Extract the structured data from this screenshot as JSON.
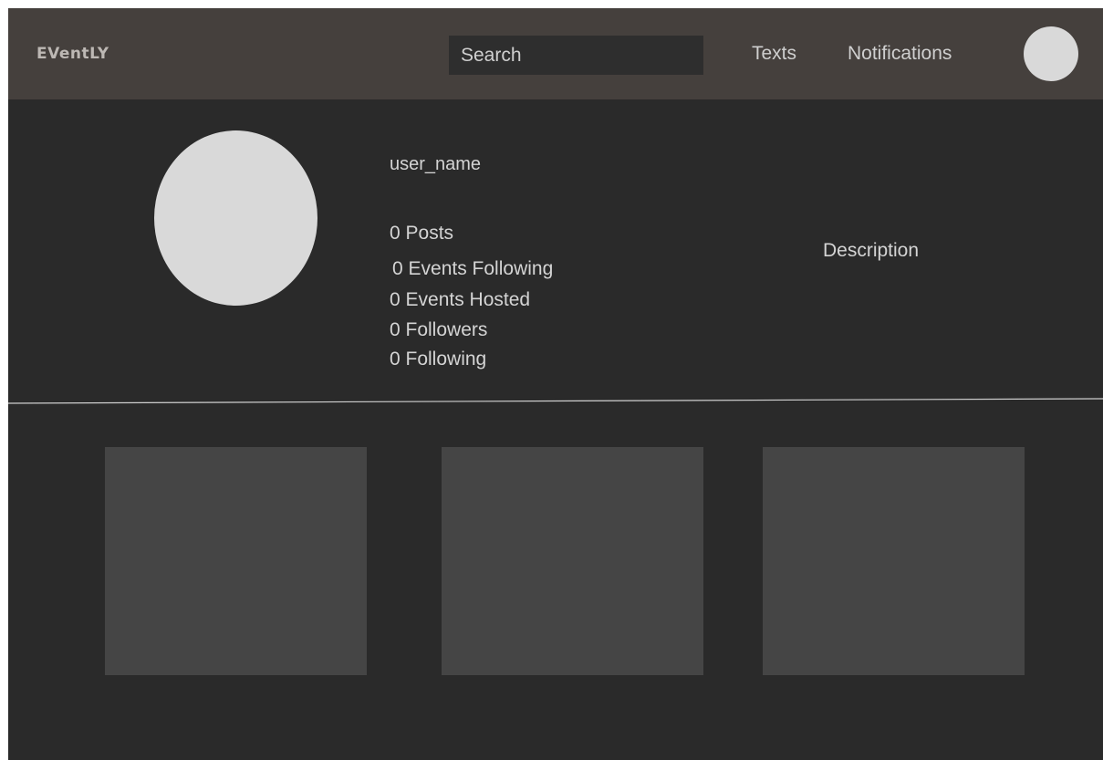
{
  "header": {
    "logo": "EVentLY",
    "search_placeholder": "Search",
    "nav": {
      "texts": "Texts",
      "notifications": "Notifications"
    }
  },
  "profile": {
    "username": "user_name",
    "stats": {
      "posts": "0 Posts",
      "events_following": "0 Events Following",
      "events_hosted": "0 Events Hosted",
      "followers": "0 Followers",
      "following": "0 Following"
    },
    "description": "Description"
  },
  "colors": {
    "background": "#2a2a2a",
    "header": "#45403d",
    "tile": "#454545",
    "avatar": "#d9d9d9",
    "text": "#d4d4d4"
  }
}
